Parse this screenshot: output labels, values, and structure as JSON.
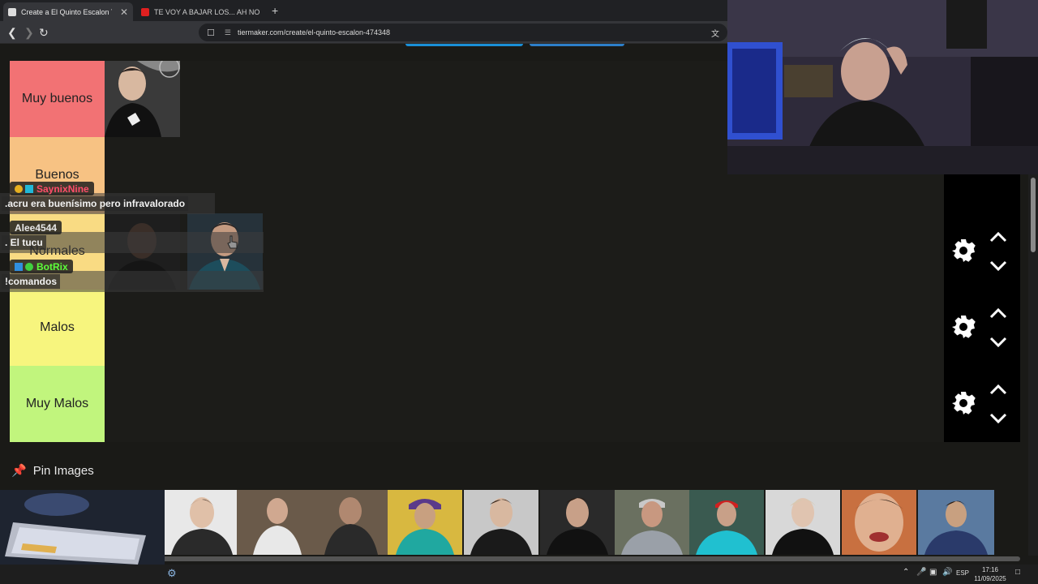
{
  "browser": {
    "tabs": [
      {
        "title": "Create a El Quinto Escalon Tier L",
        "active": true
      },
      {
        "title": "TE VOY A BAJAR LOS... AH NO PARA",
        "active": false
      }
    ],
    "new_tab": "+",
    "tab_close": "✕",
    "url": "tiermaker.com/create/el-quinto-escalon-474348"
  },
  "tiers": [
    {
      "label": "Muy buenos",
      "color": "#f27274"
    },
    {
      "label": "Buenos",
      "color": "#f7c283"
    },
    {
      "label": "Normales",
      "color": "#f9db83"
    },
    {
      "label": "Malos",
      "color": "#f7f57e"
    },
    {
      "label": "Muy Malos",
      "color": "#c1f57d"
    }
  ],
  "pin_images": {
    "label": "Pin Images",
    "icon": "pin-icon"
  },
  "chat": [
    {
      "user": "SaynixNine",
      "message": ".acru era buenísimo pero infravalorado",
      "color": "#ff4d6a"
    },
    {
      "user": "Alee4544",
      "message": ". El tucu",
      "color": "#e8e8e8"
    },
    {
      "user": "BotRix",
      "message": "!comandos",
      "color": "#5cff3a"
    }
  ],
  "taskbar": {
    "language": "ESP",
    "time": "17:16",
    "date": "11/09/2025"
  }
}
